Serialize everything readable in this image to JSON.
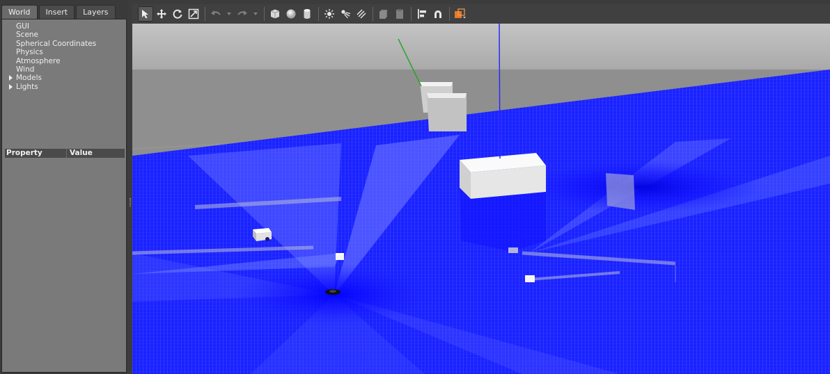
{
  "tabs": [
    {
      "label": "World",
      "active": true
    },
    {
      "label": "Insert",
      "active": false
    },
    {
      "label": "Layers",
      "active": false
    }
  ],
  "world_tree": [
    {
      "label": "GUI",
      "expandable": false
    },
    {
      "label": "Scene",
      "expandable": false
    },
    {
      "label": "Spherical Coordinates",
      "expandable": false
    },
    {
      "label": "Physics",
      "expandable": false
    },
    {
      "label": "Atmosphere",
      "expandable": false
    },
    {
      "label": "Wind",
      "expandable": false
    },
    {
      "label": "Models",
      "expandable": true
    },
    {
      "label": "Lights",
      "expandable": true
    }
  ],
  "property_table": {
    "col_property": "Property",
    "col_value": "Value"
  },
  "toolbar": {
    "tools": [
      "select-mode",
      "translate-mode",
      "rotate-mode",
      "scale-mode",
      "undo",
      "undo-history",
      "redo",
      "redo-history",
      "box-shape",
      "sphere-shape",
      "cylinder-shape",
      "point-light",
      "spot-light",
      "directional-light",
      "copy",
      "paste",
      "align",
      "snap",
      "change-view"
    ]
  },
  "colors": {
    "laser": "#1a22ff",
    "ground": "#8d8d8d",
    "sky": "#b0b0b0",
    "panel": "#7a7a7a",
    "x_axis": "#2aa52a",
    "z_axis": "#2a2aff"
  }
}
